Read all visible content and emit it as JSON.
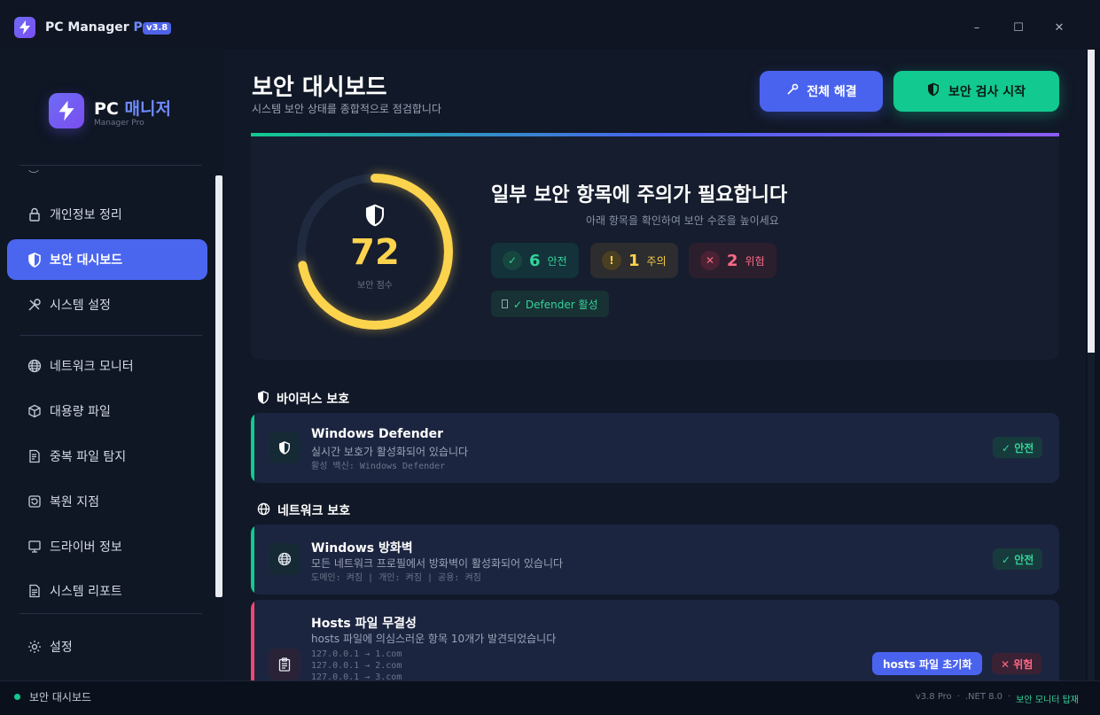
{
  "titlebar": {
    "app": "PC Manager",
    "pro": "Pro",
    "version": "v3.8",
    "minimize": "–",
    "maximize": "☐",
    "close": "✕"
  },
  "sidebar": {
    "brand_prefix": "PC",
    "brand_name": "매니저",
    "brand_sub": "Manager Pro",
    "items": [
      {
        "label": "개인정보 정리",
        "icon": "lock-icon"
      },
      {
        "label": "보안 대시보드",
        "icon": "shield-icon",
        "active": true
      },
      {
        "label": "시스템 설정",
        "icon": "wrench-icon"
      },
      {
        "label": "네트워크 모니터",
        "icon": "globe-icon"
      },
      {
        "label": "대용량 파일",
        "icon": "box-icon"
      },
      {
        "label": "중복 파일 탐지",
        "icon": "file-search-icon"
      },
      {
        "label": "복원 지점",
        "icon": "restore-icon"
      },
      {
        "label": "드라이버 정보",
        "icon": "computer-icon"
      },
      {
        "label": "시스템 리포트",
        "icon": "report-icon"
      },
      {
        "label": "설정",
        "icon": "gear-icon"
      }
    ]
  },
  "header": {
    "title": "보안 대시보드",
    "subtitle": "시스템 보안 상태를 종합적으로 점검합니다",
    "fix_all": "전체 해결",
    "start_scan": "보안 검사 시작"
  },
  "summary": {
    "score": "72",
    "score_fraction": 0.72,
    "score_label": "보안 점수",
    "headline": "일부 보안 항목에 주의가 필요합니다",
    "subline": "아래 항목을 확인하여 보안 수준을 높이세요",
    "safe_count": "6",
    "safe_label": "안전",
    "warn_count": "1",
    "warn_label": "주의",
    "danger_count": "2",
    "danger_label": "위험",
    "defender": "✓ Defender 활성",
    "colors": {
      "safe": "#34d399",
      "warn": "#fcd34d",
      "danger": "#fb6a86",
      "accent": "#4a63ef"
    }
  },
  "sections": {
    "virus": {
      "title": "바이러스 보호",
      "card": {
        "title": "Windows Defender",
        "desc": "실시간 보호가 활성화되어 있습니다",
        "detail": "활성 백신: Windows Defender",
        "status": "✓ 안전"
      }
    },
    "network": {
      "title": "네트워크 보호",
      "firewall": {
        "title": "Windows 방화벽",
        "desc": "모든 네트워크 프로필에서 방화벽이 활성화되어 있습니다",
        "detail": "도메인: 켜짐 | 개인: 켜짐 | 공용: 켜짐",
        "status": "✓ 안전"
      },
      "hosts": {
        "title": "Hosts 파일 무결성",
        "desc": "hosts 파일에 의심스러운 항목 10개가 발견되었습니다",
        "lines": [
          "127.0.0.1 → 1.com",
          "127.0.0.1 → 2.com",
          "127.0.0.1 → 3.com"
        ],
        "action": "hosts 파일 초기화",
        "status": "✕ 위험"
      }
    }
  },
  "statusbar": {
    "left": "보안 대시보드",
    "version": "v3.8 Pro",
    "sep": "·",
    "runtime": ".NET 8.0",
    "monitor": "보안 모니터 탑재"
  }
}
